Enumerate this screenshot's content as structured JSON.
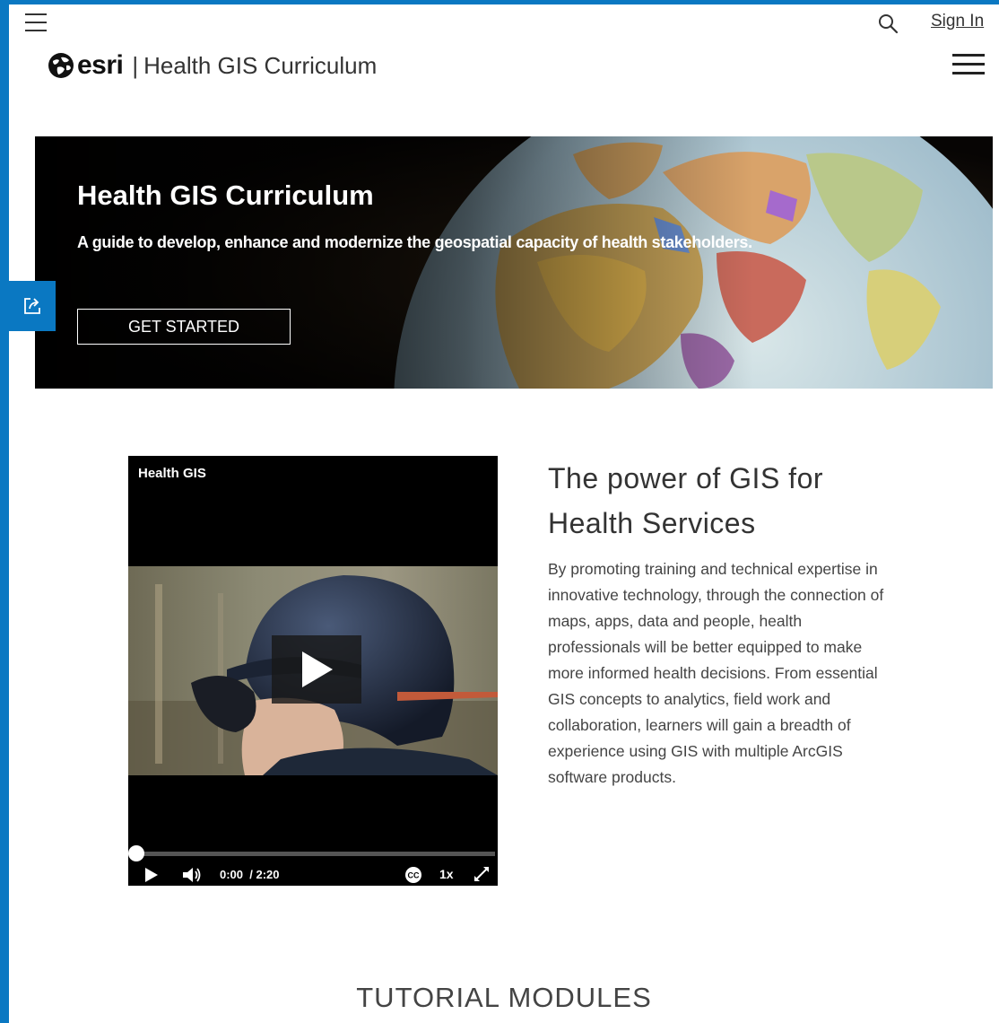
{
  "header": {
    "sign_in": "Sign In",
    "brand_word": "esri",
    "brand_title": "Health GIS Curriculum",
    "separator": "|"
  },
  "hero": {
    "title": "Health GIS Curriculum",
    "subtitle": "A guide to develop, enhance and modernize the geospatial capacity of health stakeholders.",
    "button": "GET STARTED"
  },
  "video": {
    "title": "Health GIS",
    "current_time": "0:00",
    "duration": "/ 2:20",
    "speed": "1x",
    "progress": 0
  },
  "intro": {
    "title": "The power of GIS for Health Services",
    "body": "By promoting training and technical expertise in innovative technology, through the connection of maps, apps, data and people, health professionals will be better equipped to make more informed health decisions. From essential GIS concepts to analytics, field work and collaboration, learners will gain a breadth of experience using GIS with multiple ArcGIS software products."
  },
  "section": {
    "modules_heading": "TUTORIAL MODULES"
  },
  "icons": {
    "menu": "hamburger-menu-icon",
    "search": "search-icon",
    "share": "share-icon",
    "play": "play-icon",
    "volume": "volume-icon",
    "captions": "closed-captions-icon",
    "fullscreen": "fullscreen-icon"
  },
  "colors": {
    "frame_blue": "#0a78c2",
    "text_dark": "#333333"
  }
}
